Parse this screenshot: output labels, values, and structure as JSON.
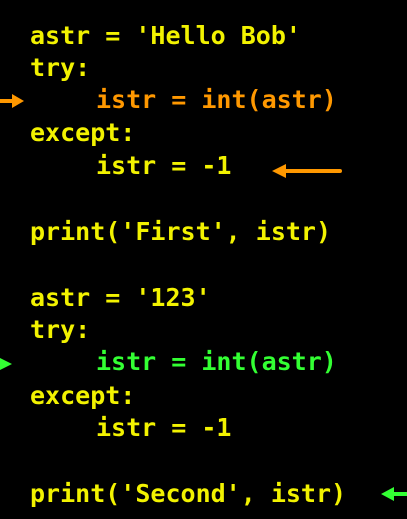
{
  "code": {
    "line1": "astr = 'Hello Bob'",
    "line2": "try:",
    "line3": "istr = int(astr)",
    "line4": "except:",
    "line5": "istr = -1",
    "line6": "print('First', istr)",
    "line7": "astr = '123'",
    "line8": "try:",
    "line9": "istr = int(astr)",
    "line10": "except:",
    "line11": "istr = -1",
    "line12": "print('Second', istr)"
  },
  "colors": {
    "background": "#000000",
    "code_default": "#f2f200",
    "highlight_first": "#ff9800",
    "highlight_second": "#33ff33"
  },
  "icons": {
    "first_try_marker": "arrow-right-icon",
    "except_marker": "arrow-left-icon",
    "second_try_marker": "arrow-right-icon",
    "second_print_marker": "arrow-left-icon"
  }
}
